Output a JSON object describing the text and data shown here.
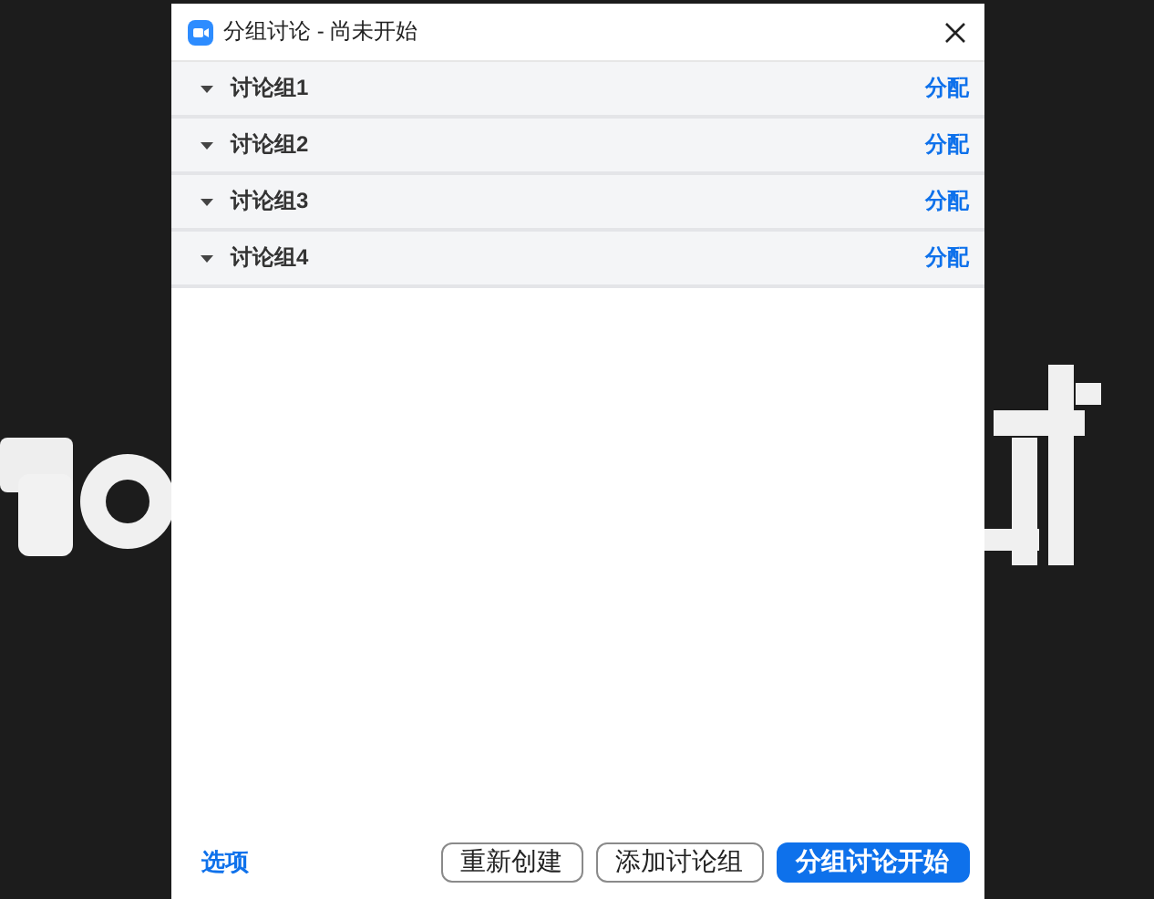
{
  "window": {
    "title": "分组讨论 - 尚未开始"
  },
  "groups": [
    {
      "name": "讨论组1",
      "action": "分配"
    },
    {
      "name": "讨论组2",
      "action": "分配"
    },
    {
      "name": "讨论组3",
      "action": "分配"
    },
    {
      "name": "讨论组4",
      "action": "分配"
    }
  ],
  "footer": {
    "options_link": "选项",
    "buttons": [
      {
        "label": "重新创建",
        "kind": "outline"
      },
      {
        "label": "添加讨论组",
        "kind": "outline"
      },
      {
        "label": "分组讨论开始",
        "kind": "primary"
      }
    ]
  }
}
